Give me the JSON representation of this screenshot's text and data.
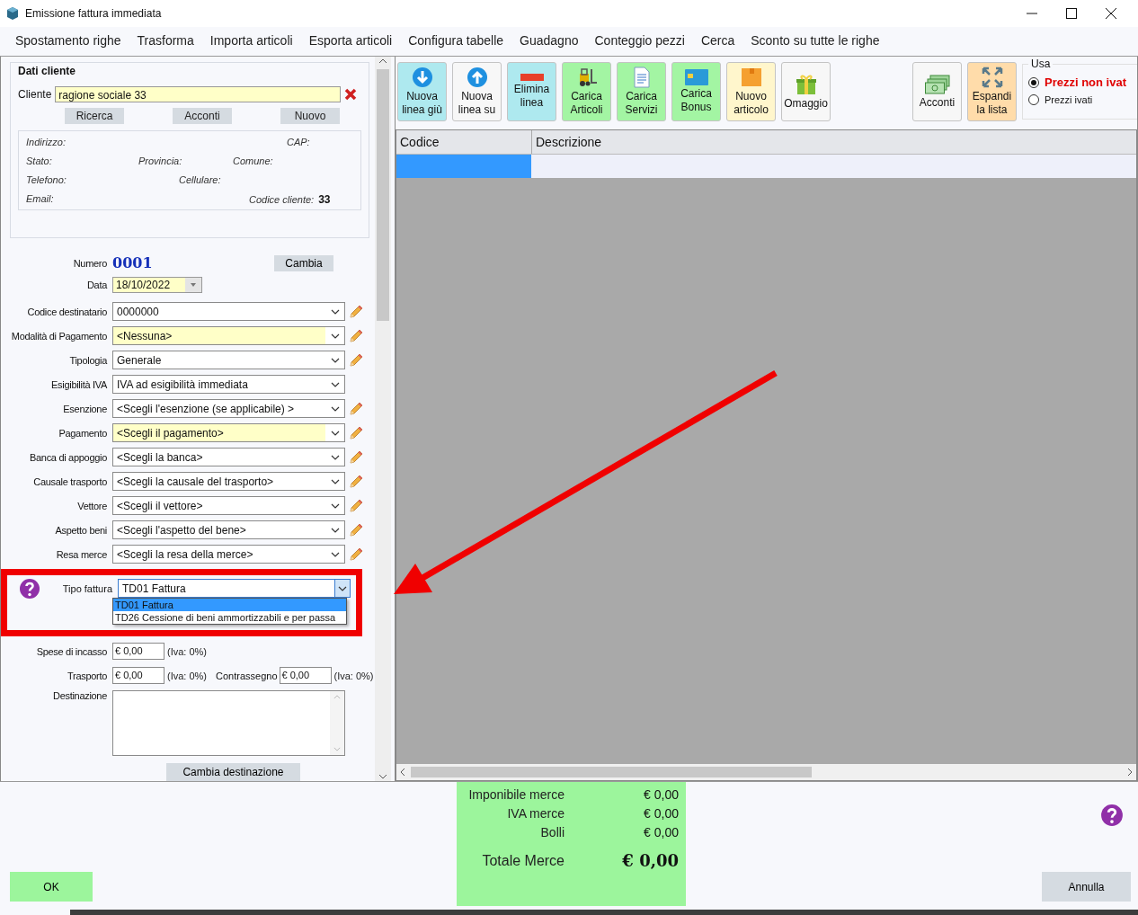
{
  "window": {
    "title": "Emissione fattura immediata"
  },
  "menu": [
    "Spostamento righe",
    "Trasforma",
    "Importa articoli",
    "Esporta articoli",
    "Configura tabelle",
    "Guadagno",
    "Conteggio pezzi",
    "Cerca",
    "Sconto su tutte le righe"
  ],
  "client": {
    "title": "Dati cliente",
    "label": "Cliente",
    "value": "ragione sociale 33",
    "buttons": [
      "Ricerca",
      "Acconti",
      "Nuovo"
    ],
    "details": [
      [
        {
          "label": "Indirizzo:"
        },
        {
          "label": "CAP:"
        }
      ],
      [
        {
          "label": "Stato:"
        },
        {
          "label": "Provincia:"
        },
        {
          "label": "Comune:"
        }
      ],
      [
        {
          "label": "Telefono:"
        },
        {
          "label": "Cellulare:"
        }
      ],
      [
        {
          "label": "Email:"
        },
        {
          "label": "Codice cliente:",
          "value": "33"
        }
      ]
    ]
  },
  "number": {
    "label": "Numero",
    "value": "0001",
    "button": "Cambia"
  },
  "date": {
    "label": "Data",
    "value": "18/10/2022"
  },
  "fields": [
    {
      "label": "Codice destinatario",
      "value": "0000000",
      "highlighted": false,
      "editable": true
    },
    {
      "label": "Modalità di Pagamento",
      "value": "<Nessuna>",
      "highlighted": true,
      "editable": true
    },
    {
      "label": "Tipologia",
      "value": "Generale",
      "highlighted": false,
      "editable": true
    },
    {
      "label": "Esigibilità IVA",
      "value": "IVA ad esigibilità immediata",
      "highlighted": false,
      "editable": false
    },
    {
      "label": "Esenzione",
      "value": "<Scegli l'esenzione (se applicabile) >",
      "highlighted": false,
      "editable": true
    },
    {
      "label": "Pagamento",
      "value": "<Scegli il pagamento>",
      "highlighted": true,
      "editable": true
    },
    {
      "label": "Banca di appoggio",
      "value": "<Scegli la banca>",
      "highlighted": false,
      "editable": true
    },
    {
      "label": "Causale trasporto",
      "value": "<Scegli la causale del trasporto>",
      "highlighted": false,
      "editable": true
    },
    {
      "label": "Vettore",
      "value": "<Scegli il vettore>",
      "highlighted": false,
      "editable": true
    },
    {
      "label": "Aspetto beni",
      "value": "<Scegli l'aspetto del bene>",
      "highlighted": false,
      "editable": true
    },
    {
      "label": "Resa merce",
      "value": "<Scegli la resa della merce>",
      "highlighted": false,
      "editable": true
    }
  ],
  "invoice_type": {
    "label": "Tipo fattura",
    "value": "TD01 Fattura",
    "options": [
      {
        "label": "TD01 Fattura",
        "selected": true
      },
      {
        "label": "TD26 Cessione di beni ammortizzabili e per passa",
        "selected": false
      }
    ]
  },
  "charges": {
    "label": "Spese di incasso",
    "value": "€ 0,00",
    "vat": "(Iva: 0%)"
  },
  "shipping": {
    "label": "Trasporto",
    "value": "€ 0,00",
    "vat": "(Iva: 0%)",
    "cod_label": "Contrassegno",
    "cod_value": "€ 0,00",
    "cod_vat": "(Iva: 0%)"
  },
  "destination": {
    "label": "Destinazione",
    "button": "Cambia destinazione"
  },
  "toolbar": [
    {
      "label": "Nuova\nlinea giù",
      "kind": "arrow-down",
      "color": "#aee9ef"
    },
    {
      "label": "Nuova\nlinea su",
      "kind": "arrow-up",
      "color": "#f7f7f7"
    },
    {
      "label": "Elimina\nlinea",
      "kind": "minus",
      "color": "#aee9ef"
    },
    {
      "label": "Carica\nArticoli",
      "kind": "forklift",
      "color": "#a3f5a3"
    },
    {
      "label": "Carica\nServizi",
      "kind": "document",
      "color": "#a3f5a3"
    },
    {
      "label": "Carica\nBonus",
      "kind": "card",
      "color": "#a3f5a3"
    },
    {
      "label": "Nuovo\narticolo",
      "kind": "box",
      "color": "#fff6cc"
    },
    {
      "label": "Omaggio",
      "kind": "gift",
      "color": "#f7f7f7"
    }
  ],
  "toolbar_right": [
    {
      "label": "Acconti",
      "kind": "money",
      "color": "#f7f7f7"
    },
    {
      "label": "Espandi\nla lista",
      "kind": "expand",
      "color": "#ffdcaa"
    }
  ],
  "price_mode": {
    "title": "Usa",
    "options": [
      {
        "label": "Prezzi non ivat",
        "selected": true
      },
      {
        "label": "Prezzi ivati",
        "selected": false
      }
    ]
  },
  "grid": {
    "columns": [
      "Codice",
      "Descrizione"
    ]
  },
  "totals": {
    "rows": [
      {
        "label": "Imponibile merce",
        "value": "€ 0,00"
      },
      {
        "label": "IVA merce",
        "value": "€ 0,00"
      },
      {
        "label": "Bolli",
        "value": "€ 0,00"
      }
    ],
    "total": {
      "label": "Totale Merce",
      "value": "€ 0,00"
    }
  },
  "buttons": {
    "ok": "OK",
    "cancel": "Annulla"
  }
}
